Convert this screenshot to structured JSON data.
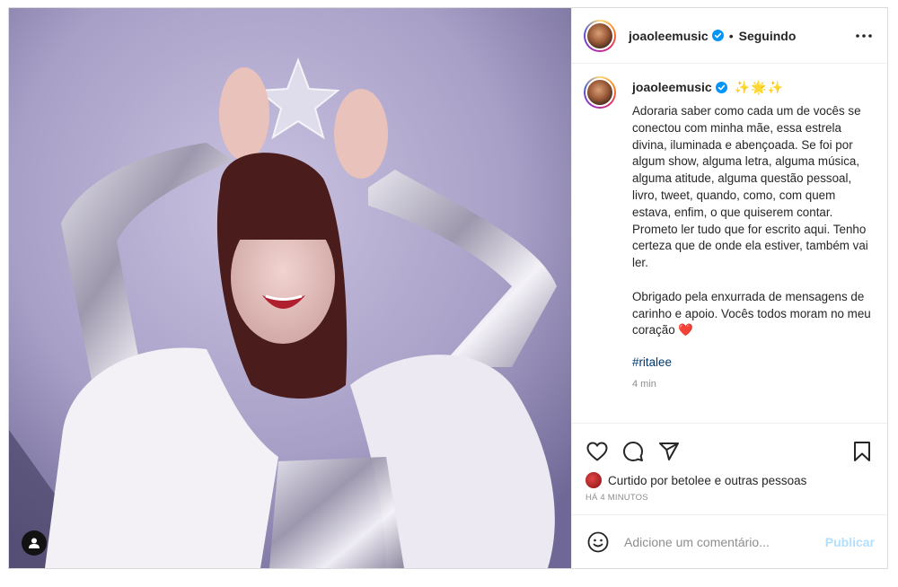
{
  "post": {
    "author": {
      "username": "joaoleemusic",
      "verified": true,
      "follow_status": "Seguindo",
      "separator": "•"
    },
    "caption": {
      "username": "joaoleemusic",
      "emojis": "✨🌟✨",
      "paragraph_1": "Adoraria saber como cada um de vocês se conectou com minha mãe, essa estrela divina, iluminada e abençoada. Se foi por algum show, alguma letra, alguma música, alguma atitude, alguma questão pessoal, livro, tweet, quando, como, com quem estava, enfim, o que quiserem contar. Prometo ler tudo que for escrito aqui. Tenho certeza que de onde ela estiver, também vai ler.",
      "paragraph_2": "Obrigado pela enxurrada de mensagens de carinho e apoio. Vocês todos moram no meu coração",
      "heart": "❤️",
      "hashtag": "#ritalee",
      "time_ago": "4 min"
    },
    "likes": {
      "text": "Curtido por betolee e outras pessoas",
      "time_ago": "HÁ 4 MINUTOS"
    },
    "comment_box": {
      "placeholder": "Adicione um comentário...",
      "publish_label": "Publicar"
    },
    "icons": {
      "more": "more-horizontal-icon",
      "like": "heart-outline-icon",
      "comment": "comment-bubble-icon",
      "share": "paper-plane-icon",
      "save": "bookmark-icon",
      "emoji": "smiley-icon",
      "tagged": "user-tag-icon"
    },
    "colors": {
      "verified_blue": "#0095f6",
      "publish_disabled": "#b2dffc",
      "hashtag": "#00376b",
      "muted": "#8e8e8e"
    }
  }
}
